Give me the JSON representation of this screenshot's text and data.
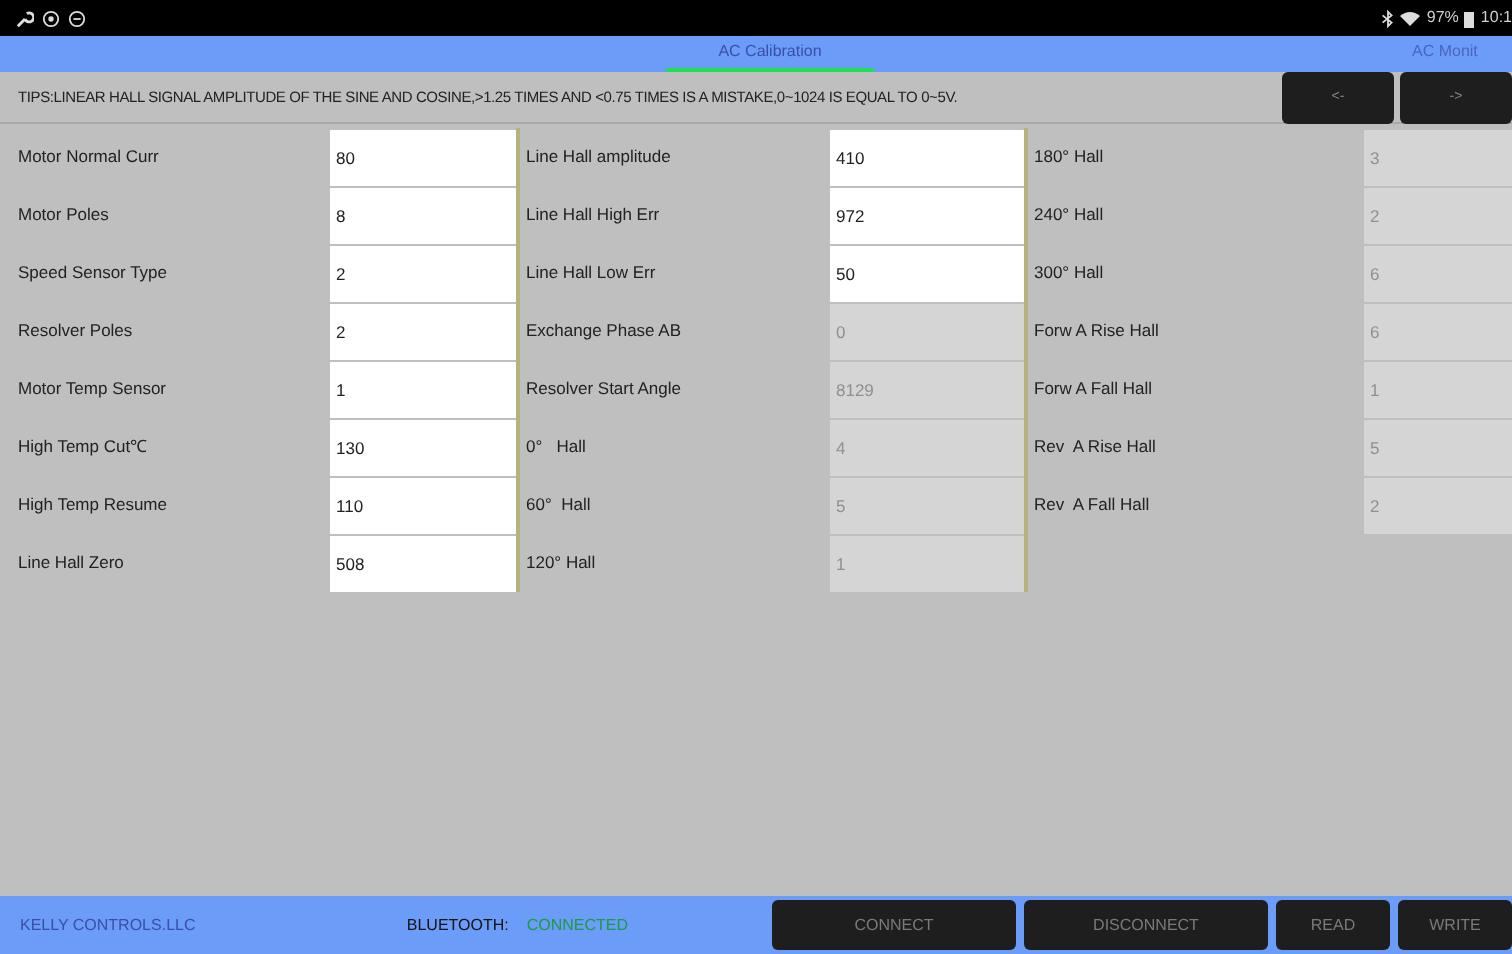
{
  "status_bar": {
    "battery": "97%",
    "time": "10:1"
  },
  "tabs": [
    {
      "label": "AC Calibration",
      "selected": true
    },
    {
      "label": "AC Monit",
      "selected": false
    }
  ],
  "tips": "TIPS:LINEAR HALL SIGNAL AMPLITUDE OF THE SINE AND COSINE,>1.25 TIMES AND <0.75 TIMES IS A MISTAKE,0~1024 IS EQUAL TO 0~5V.",
  "nav_buttons": [
    "<-",
    "->"
  ],
  "columns": [
    [
      {
        "label": "Motor Normal Curr",
        "value": "80",
        "disabled": false
      },
      {
        "label": "Motor Poles",
        "value": "8",
        "disabled": false
      },
      {
        "label": "Speed Sensor Type",
        "value": "2",
        "disabled": false
      },
      {
        "label": "Resolver Poles",
        "value": "2",
        "disabled": false
      },
      {
        "label": "Motor Temp Sensor",
        "value": "1",
        "disabled": false
      },
      {
        "label": "High Temp Cut℃",
        "value": "130",
        "disabled": false
      },
      {
        "label": "High Temp Resume",
        "value": "110",
        "disabled": false
      },
      {
        "label": "Line Hall Zero",
        "value": "508",
        "disabled": false
      }
    ],
    [
      {
        "label": "Line Hall amplitude",
        "value": "410",
        "disabled": false
      },
      {
        "label": "Line Hall High Err",
        "value": "972",
        "disabled": false
      },
      {
        "label": "Line Hall Low Err",
        "value": "50",
        "disabled": false
      },
      {
        "label": "Exchange Phase AB",
        "value": "0",
        "disabled": true
      },
      {
        "label": "Resolver Start Angle",
        "value": "8129",
        "disabled": true
      },
      {
        "label": "0°   Hall",
        "value": "4",
        "disabled": true
      },
      {
        "label": "60°  Hall",
        "value": "5",
        "disabled": true
      },
      {
        "label": "120° Hall",
        "value": "1",
        "disabled": true
      }
    ],
    [
      {
        "label": "180° Hall",
        "value": "3",
        "disabled": true
      },
      {
        "label": "240° Hall",
        "value": "2",
        "disabled": true
      },
      {
        "label": "300° Hall",
        "value": "6",
        "disabled": true
      },
      {
        "label": "Forw A Rise Hall",
        "value": "6",
        "disabled": true
      },
      {
        "label": "Forw A Fall Hall",
        "value": "1",
        "disabled": true
      },
      {
        "label": "Rev  A Rise Hall",
        "value": "5",
        "disabled": true
      },
      {
        "label": "Rev  A Fall Hall",
        "value": "2",
        "disabled": true
      }
    ]
  ],
  "footer": {
    "company": "KELLY CONTROLS.LLC",
    "bluetooth_label": "BLUETOOTH:",
    "bluetooth_status": "CONNECTED",
    "buttons": [
      "CONNECT",
      "DISCONNECT",
      "READ",
      "WRITE"
    ]
  }
}
